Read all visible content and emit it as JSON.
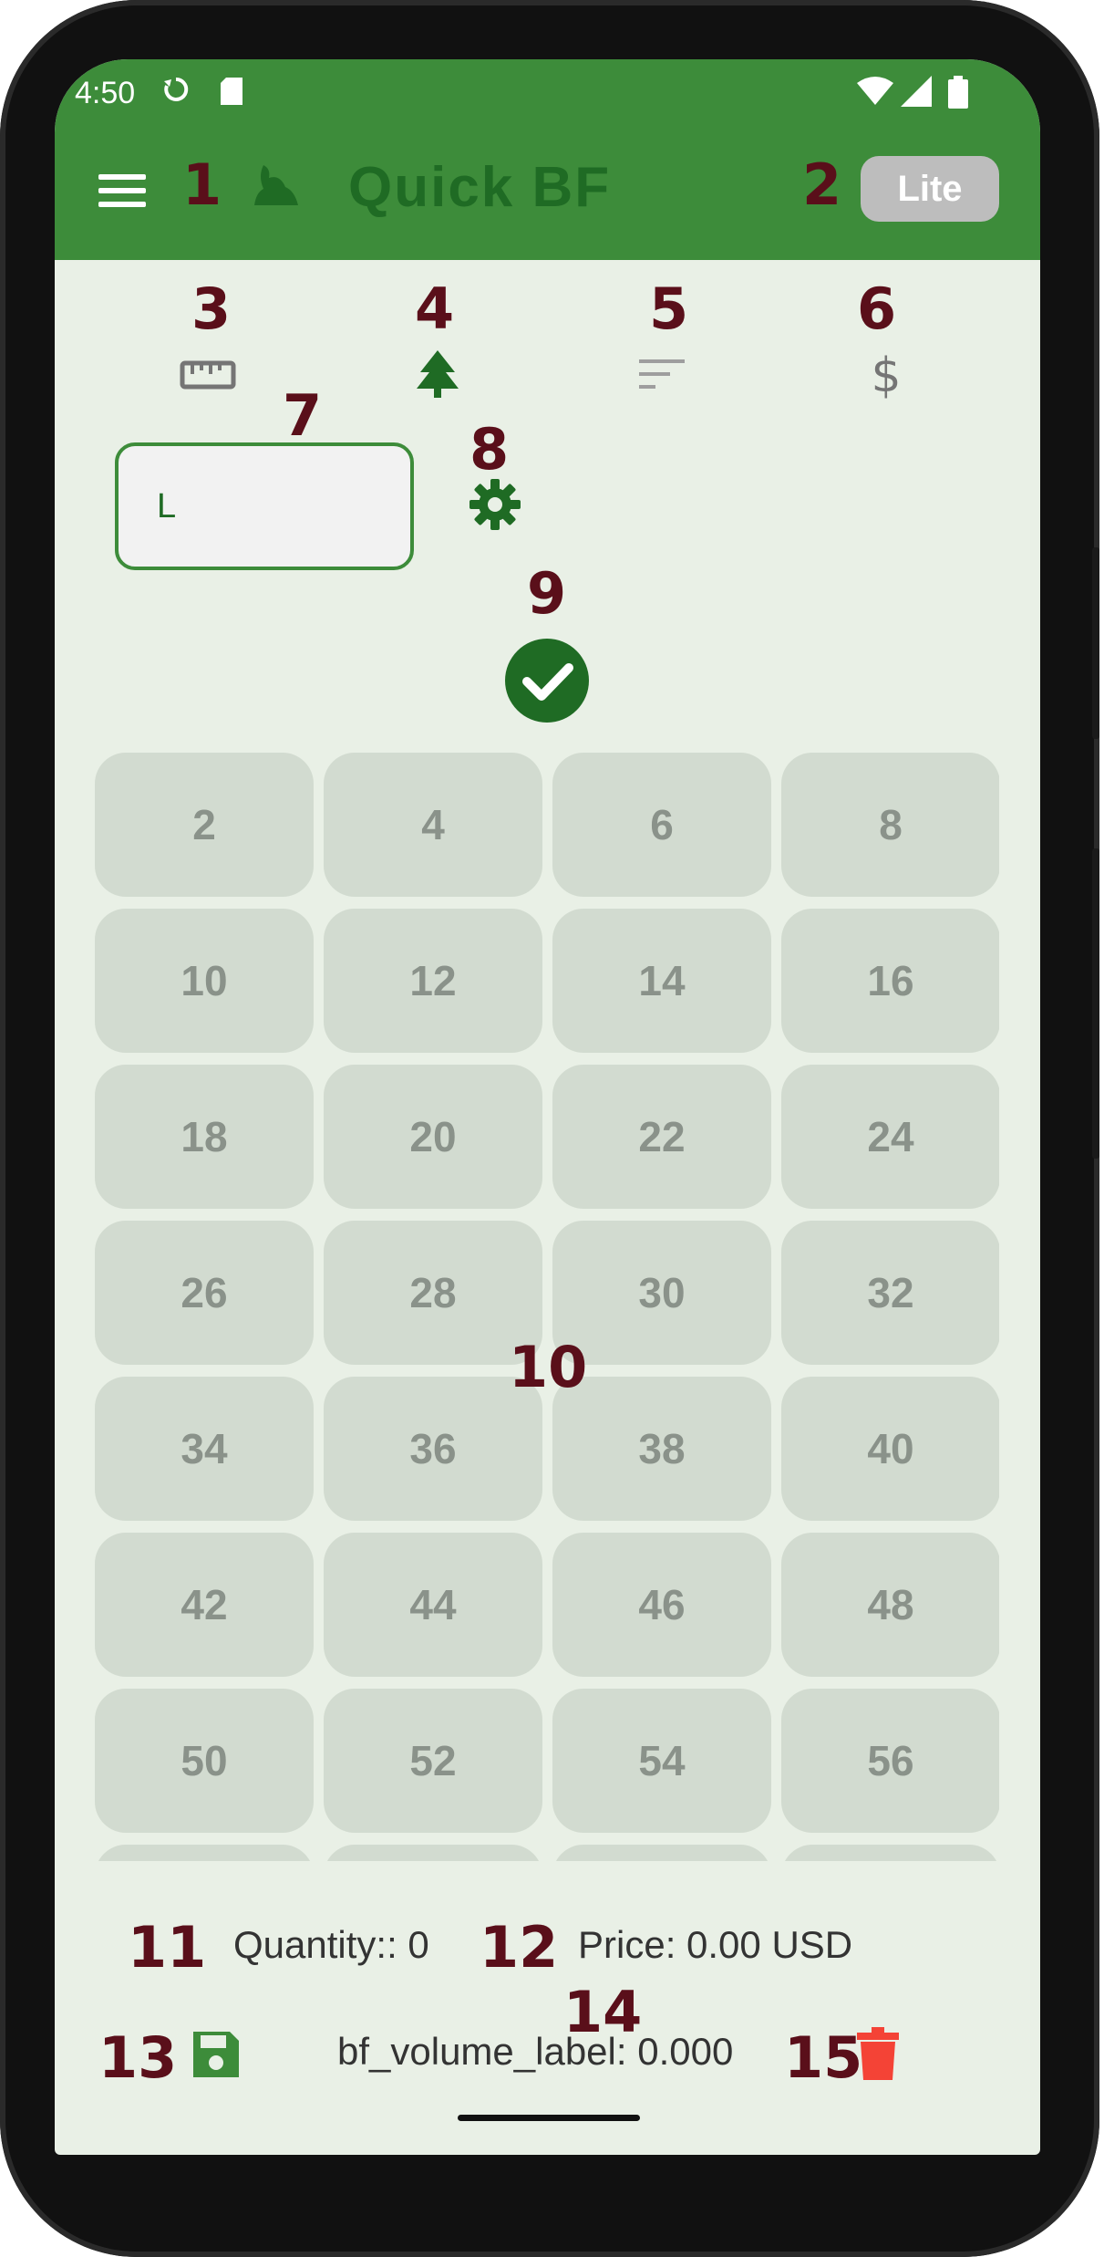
{
  "status_bar": {
    "time": "4:50"
  },
  "app_bar": {
    "title": "Quick BF",
    "lite_label": "Lite"
  },
  "annotations": [
    "1",
    "2",
    "3",
    "4",
    "5",
    "6",
    "7",
    "8",
    "9",
    "10",
    "11",
    "12",
    "13",
    "14",
    "15"
  ],
  "input": {
    "value": "L"
  },
  "grid": {
    "values": [
      "2",
      "4",
      "6",
      "8",
      "10",
      "12",
      "14",
      "16",
      "18",
      "20",
      "22",
      "24",
      "26",
      "28",
      "30",
      "32",
      "34",
      "36",
      "38",
      "40",
      "42",
      "44",
      "46",
      "48",
      "50",
      "52",
      "54",
      "56",
      "",
      "",
      "",
      ""
    ]
  },
  "footer": {
    "quantity": "Quantity:: 0",
    "price": "Price: 0.00 USD",
    "volume": "bf_volume_label: 0.000"
  },
  "colors": {
    "app_bar": "#3d8c3a",
    "accent_dark": "#1f6b24",
    "background": "#e9f0e6",
    "trash": "#f44336",
    "annotation": "#5a0f1a"
  },
  "icons": [
    "menu-icon",
    "app-logo-icon",
    "ruler-icon",
    "tree-icon",
    "sort-icon",
    "dollar-icon",
    "gear-icon",
    "check-circle-icon",
    "save-icon",
    "trash-icon"
  ]
}
